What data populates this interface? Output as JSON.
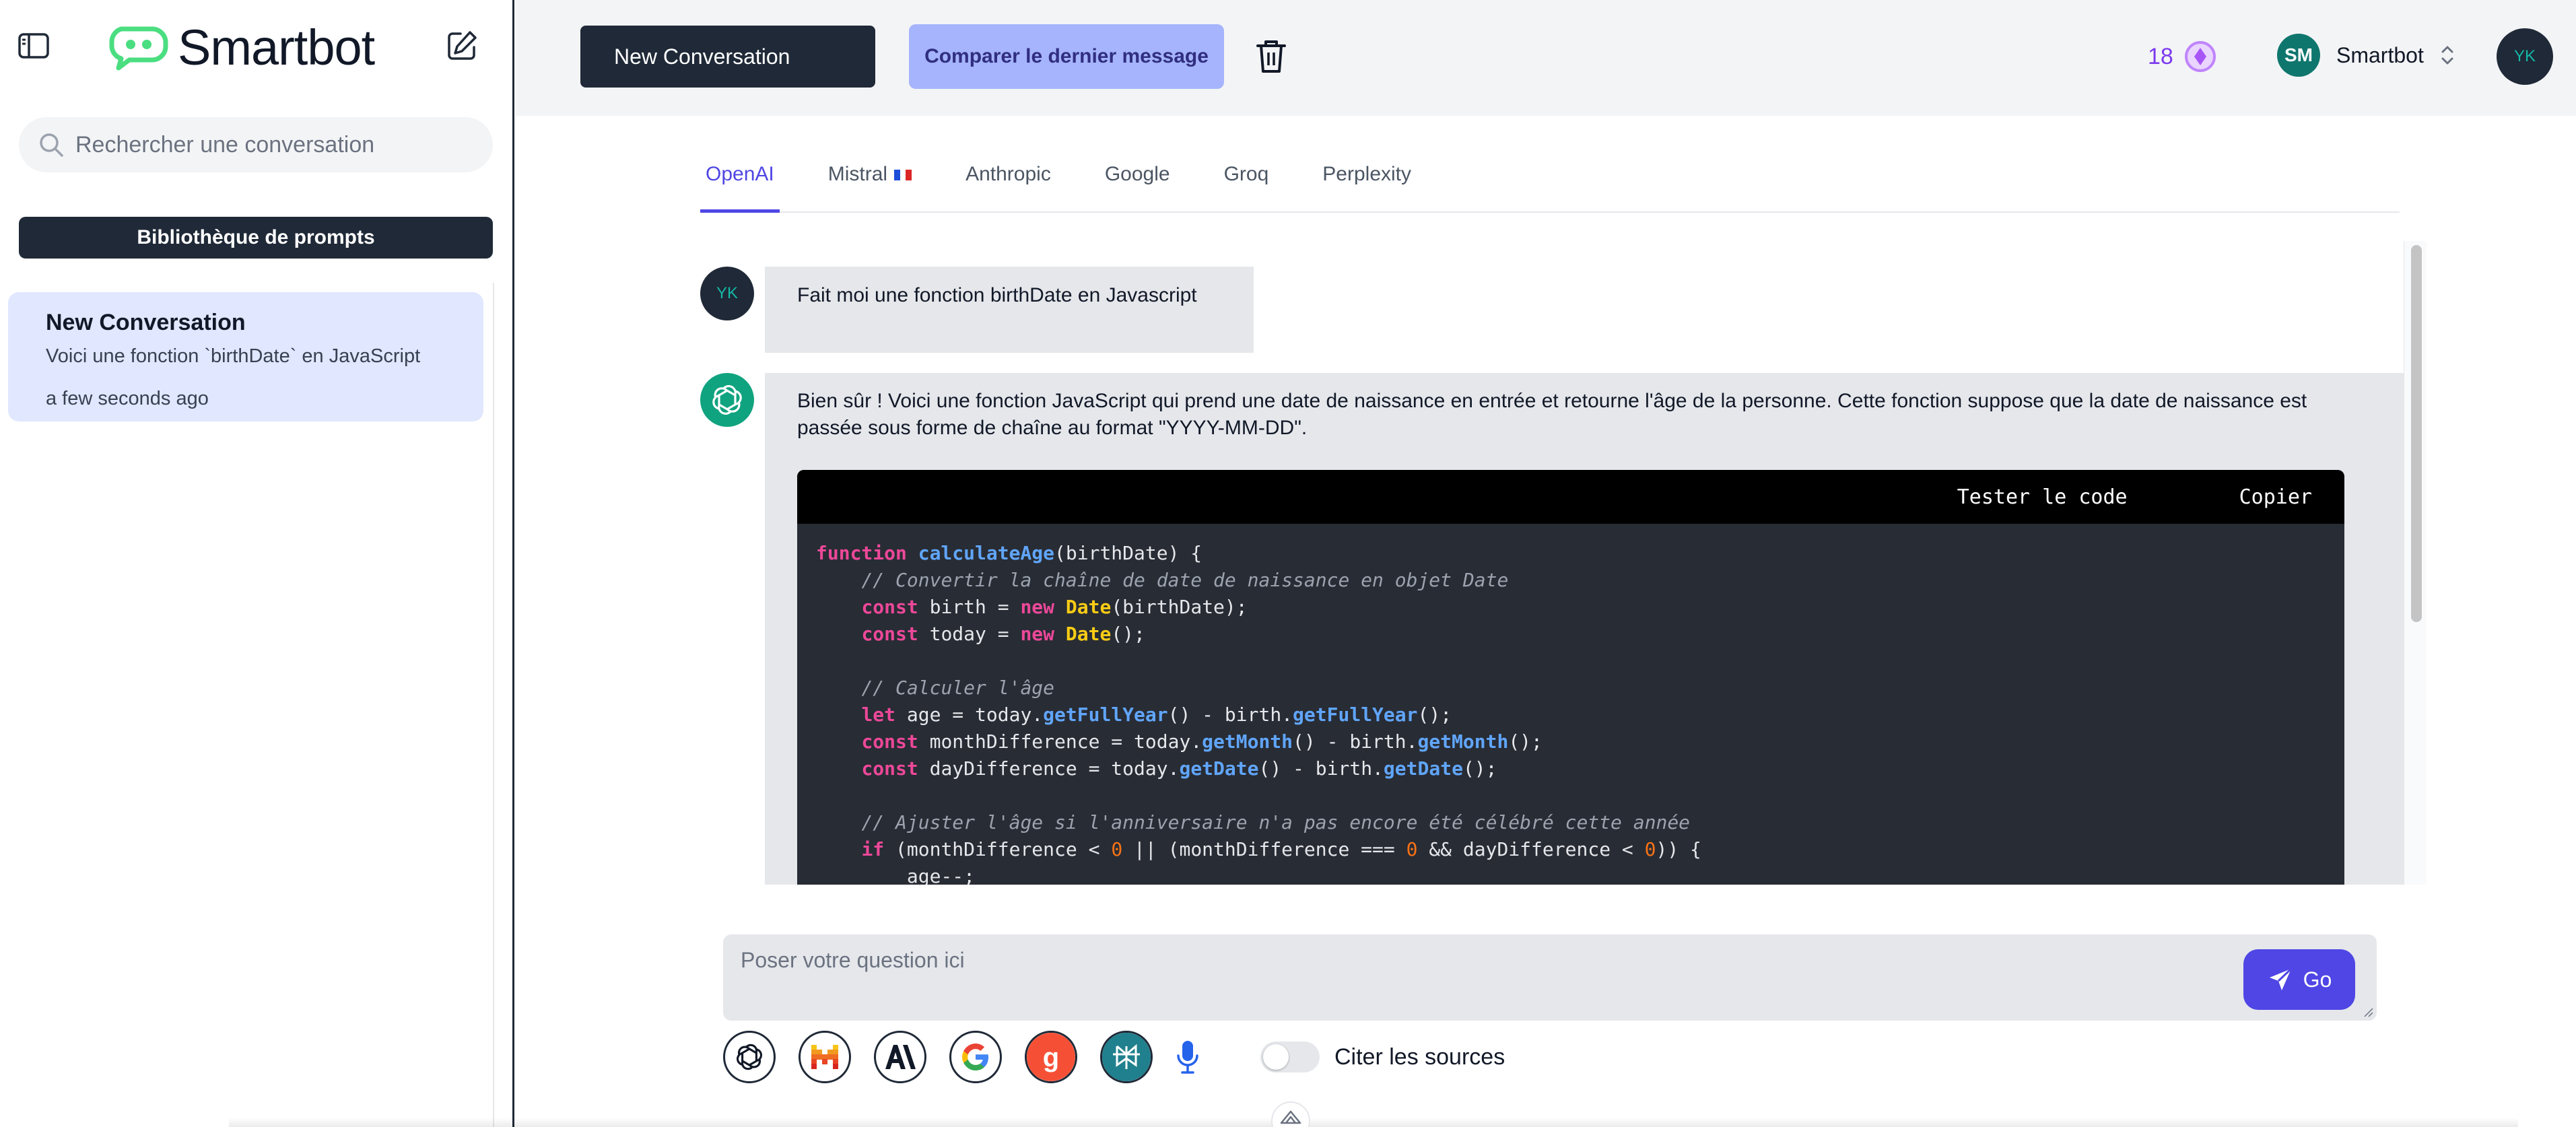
{
  "sidebar": {
    "app_name": "Smartbot",
    "search_placeholder": "Rechercher une conversation",
    "prompts_button": "Bibliothèque de prompts",
    "conversations": [
      {
        "title": "New Conversation",
        "preview": "Voici une fonction `birthDate` en JavaScript",
        "time": "a few seconds ago"
      }
    ]
  },
  "header": {
    "conversation_name": "New Conversation",
    "compare_button": "Comparer le dernier message",
    "credits": "18",
    "account_initials": "SM",
    "account_name": "Smartbot",
    "user_initials": "YK"
  },
  "tabs": [
    {
      "label": "OpenAI",
      "active": true
    },
    {
      "label": "Mistral",
      "active": false,
      "flag": "fr"
    },
    {
      "label": "Anthropic",
      "active": false
    },
    {
      "label": "Google",
      "active": false
    },
    {
      "label": "Groq",
      "active": false
    },
    {
      "label": "Perplexity",
      "active": false
    }
  ],
  "messages": [
    {
      "role": "user",
      "avatar": "YK",
      "text": "Fait moi une fonction birthDate en Javascript"
    },
    {
      "role": "assistant",
      "avatar_icon": "openai-icon",
      "text": "Bien sûr ! Voici une fonction JavaScript qui prend une date de naissance en entrée et retourne l'âge de la personne. Cette fonction suppose que la date de naissance est passée sous forme de chaîne au format \"YYYY-MM-DD\".",
      "code_actions": {
        "test": "Tester le code",
        "copy": "Copier"
      },
      "code_lines": [
        [
          {
            "t": "function",
            "c": "kw"
          },
          {
            "t": " "
          },
          {
            "t": "calculateAge",
            "c": "fn"
          },
          {
            "t": "(birthDate) {"
          }
        ],
        [
          {
            "t": "    "
          },
          {
            "t": "// Convertir la chaîne de date de naissance en objet Date",
            "c": "cm"
          }
        ],
        [
          {
            "t": "    "
          },
          {
            "t": "const",
            "c": "kw"
          },
          {
            "t": " birth = "
          },
          {
            "t": "new",
            "c": "kw"
          },
          {
            "t": " "
          },
          {
            "t": "Date",
            "c": "cls"
          },
          {
            "t": "(birthDate);"
          }
        ],
        [
          {
            "t": "    "
          },
          {
            "t": "const",
            "c": "kw"
          },
          {
            "t": " today = "
          },
          {
            "t": "new",
            "c": "kw"
          },
          {
            "t": " "
          },
          {
            "t": "Date",
            "c": "cls"
          },
          {
            "t": "();"
          }
        ],
        [
          {
            "t": ""
          }
        ],
        [
          {
            "t": "    "
          },
          {
            "t": "// Calculer l'âge",
            "c": "cm"
          }
        ],
        [
          {
            "t": "    "
          },
          {
            "t": "let",
            "c": "kw"
          },
          {
            "t": " age = today."
          },
          {
            "t": "getFullYear",
            "c": "fn"
          },
          {
            "t": "() - birth."
          },
          {
            "t": "getFullYear",
            "c": "fn"
          },
          {
            "t": "();"
          }
        ],
        [
          {
            "t": "    "
          },
          {
            "t": "const",
            "c": "kw"
          },
          {
            "t": " monthDifference = today."
          },
          {
            "t": "getMonth",
            "c": "fn"
          },
          {
            "t": "() - birth."
          },
          {
            "t": "getMonth",
            "c": "fn"
          },
          {
            "t": "();"
          }
        ],
        [
          {
            "t": "    "
          },
          {
            "t": "const",
            "c": "kw"
          },
          {
            "t": " dayDifference = today."
          },
          {
            "t": "getDate",
            "c": "fn"
          },
          {
            "t": "() - birth."
          },
          {
            "t": "getDate",
            "c": "fn"
          },
          {
            "t": "();"
          }
        ],
        [
          {
            "t": ""
          }
        ],
        [
          {
            "t": "    "
          },
          {
            "t": "// Ajuster l'âge si l'anniversaire n'a pas encore été célébré cette année",
            "c": "cm"
          }
        ],
        [
          {
            "t": "    "
          },
          {
            "t": "if",
            "c": "kw"
          },
          {
            "t": " (monthDifference < "
          },
          {
            "t": "0",
            "c": "num"
          },
          {
            "t": " || (monthDifference === "
          },
          {
            "t": "0",
            "c": "num"
          },
          {
            "t": " && dayDifference < "
          },
          {
            "t": "0",
            "c": "num"
          },
          {
            "t": ")) {"
          }
        ],
        [
          {
            "t": "        age--;"
          }
        ]
      ]
    }
  ],
  "composer": {
    "placeholder": "Poser votre question ici",
    "send_label": "Go",
    "model_icons": [
      "openai-icon",
      "mistral-icon",
      "anthropic-icon",
      "google-icon",
      "groq-icon",
      "perplexity-icon"
    ],
    "cite_label": "Citer les sources",
    "cite_enabled": false
  },
  "colors": {
    "accent": "#4f46e5",
    "compare_bg": "#a5b4fc",
    "dark": "#1f2937",
    "logo_green": "#22c55e",
    "credits_purple": "#a855f7"
  }
}
